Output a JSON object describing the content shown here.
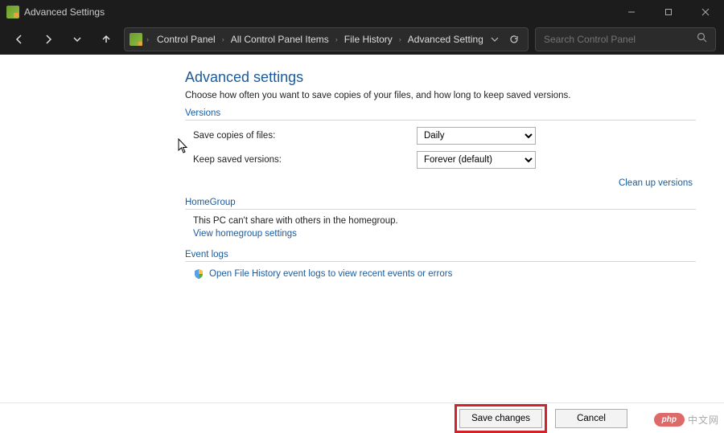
{
  "window": {
    "title": "Advanced Settings"
  },
  "breadcrumbs": {
    "items": [
      "Control Panel",
      "All Control Panel Items",
      "File History",
      "Advanced Settings"
    ]
  },
  "search": {
    "placeholder": "Search Control Panel"
  },
  "page": {
    "title": "Advanced settings",
    "description": "Choose how often you want to save copies of your files, and how long to keep saved versions."
  },
  "versions": {
    "heading": "Versions",
    "save_label": "Save copies of files:",
    "save_value": "Daily",
    "keep_label": "Keep saved versions:",
    "keep_value": "Forever (default)",
    "cleanup_link": "Clean up versions"
  },
  "homegroup": {
    "heading": "HomeGroup",
    "text": "This PC can't share with others in the homegroup.",
    "link": "View homegroup settings"
  },
  "eventlogs": {
    "heading": "Event logs",
    "link": "Open File History event logs to view recent events or errors"
  },
  "footer": {
    "save": "Save changes",
    "cancel": "Cancel"
  },
  "watermark": {
    "badge": "php",
    "text": "中文网"
  }
}
